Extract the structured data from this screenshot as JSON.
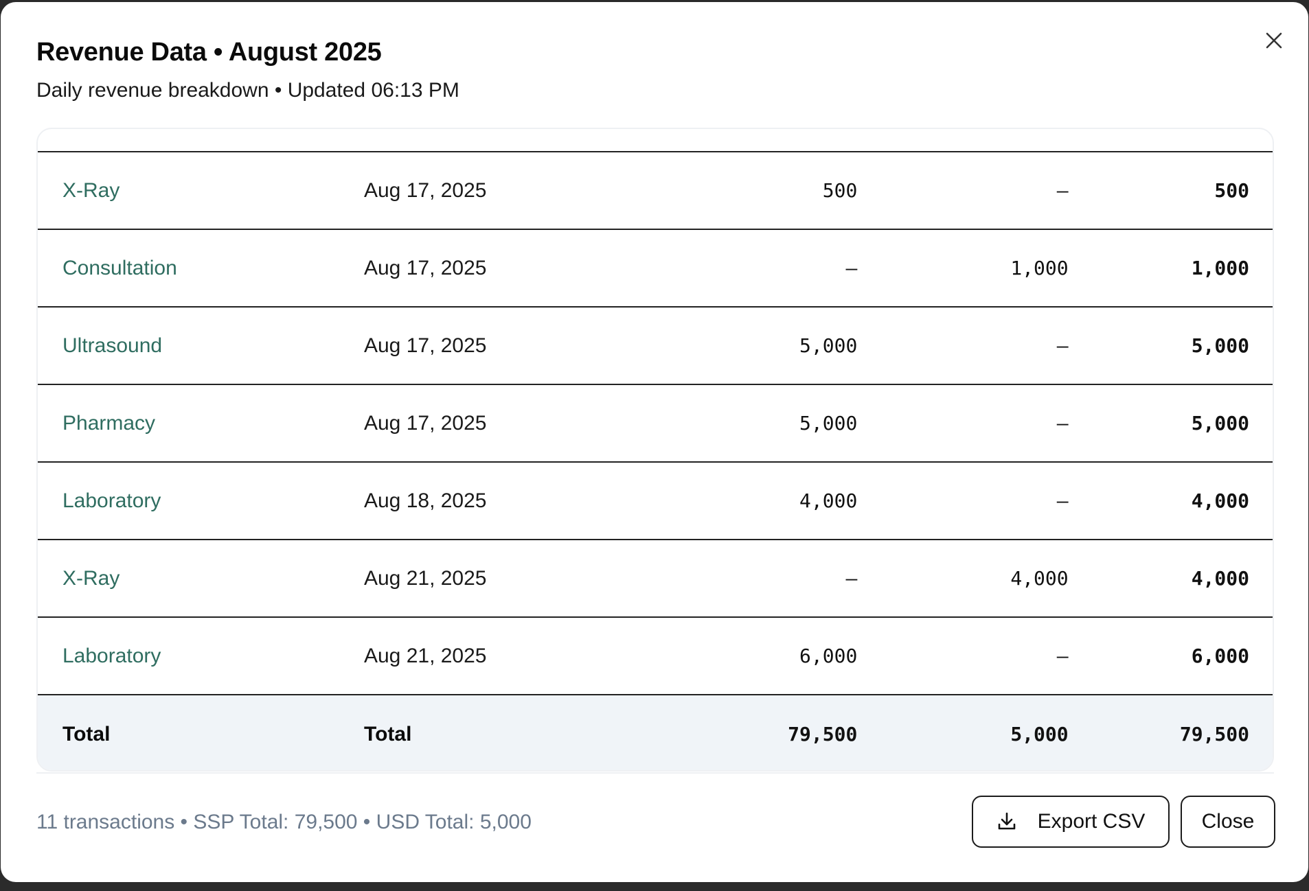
{
  "modal": {
    "title": "Revenue Data • August 2025",
    "subtitle": "Daily revenue breakdown • Updated 06:13 PM",
    "close_icon": "close-icon"
  },
  "table": {
    "rows": [
      {
        "service": "X-Ray",
        "date": "Aug 17, 2025",
        "ssp": "500",
        "usd": "—",
        "total": "500"
      },
      {
        "service": "Consultation",
        "date": "Aug 17, 2025",
        "ssp": "—",
        "usd": "1,000",
        "total": "1,000"
      },
      {
        "service": "Ultrasound",
        "date": "Aug 17, 2025",
        "ssp": "5,000",
        "usd": "—",
        "total": "5,000"
      },
      {
        "service": "Pharmacy",
        "date": "Aug 17, 2025",
        "ssp": "5,000",
        "usd": "—",
        "total": "5,000"
      },
      {
        "service": "Laboratory",
        "date": "Aug 18, 2025",
        "ssp": "4,000",
        "usd": "—",
        "total": "4,000"
      },
      {
        "service": "X-Ray",
        "date": "Aug 21, 2025",
        "ssp": "—",
        "usd": "4,000",
        "total": "4,000"
      },
      {
        "service": "Laboratory",
        "date": "Aug 21, 2025",
        "ssp": "6,000",
        "usd": "—",
        "total": "6,000"
      }
    ],
    "total_row": {
      "service": "Total",
      "date": "Total",
      "ssp": "79,500",
      "usd": "5,000",
      "total": "79,500"
    }
  },
  "footer": {
    "summary": "11 transactions • SSP Total: 79,500 • USD Total: 5,000",
    "export_label": "Export CSV",
    "export_icon": "download-icon",
    "close_label": "Close"
  },
  "colors": {
    "service_text": "#2f6d60",
    "summary_text": "#6b7a8c",
    "total_row_bg": "#f0f4f8"
  }
}
